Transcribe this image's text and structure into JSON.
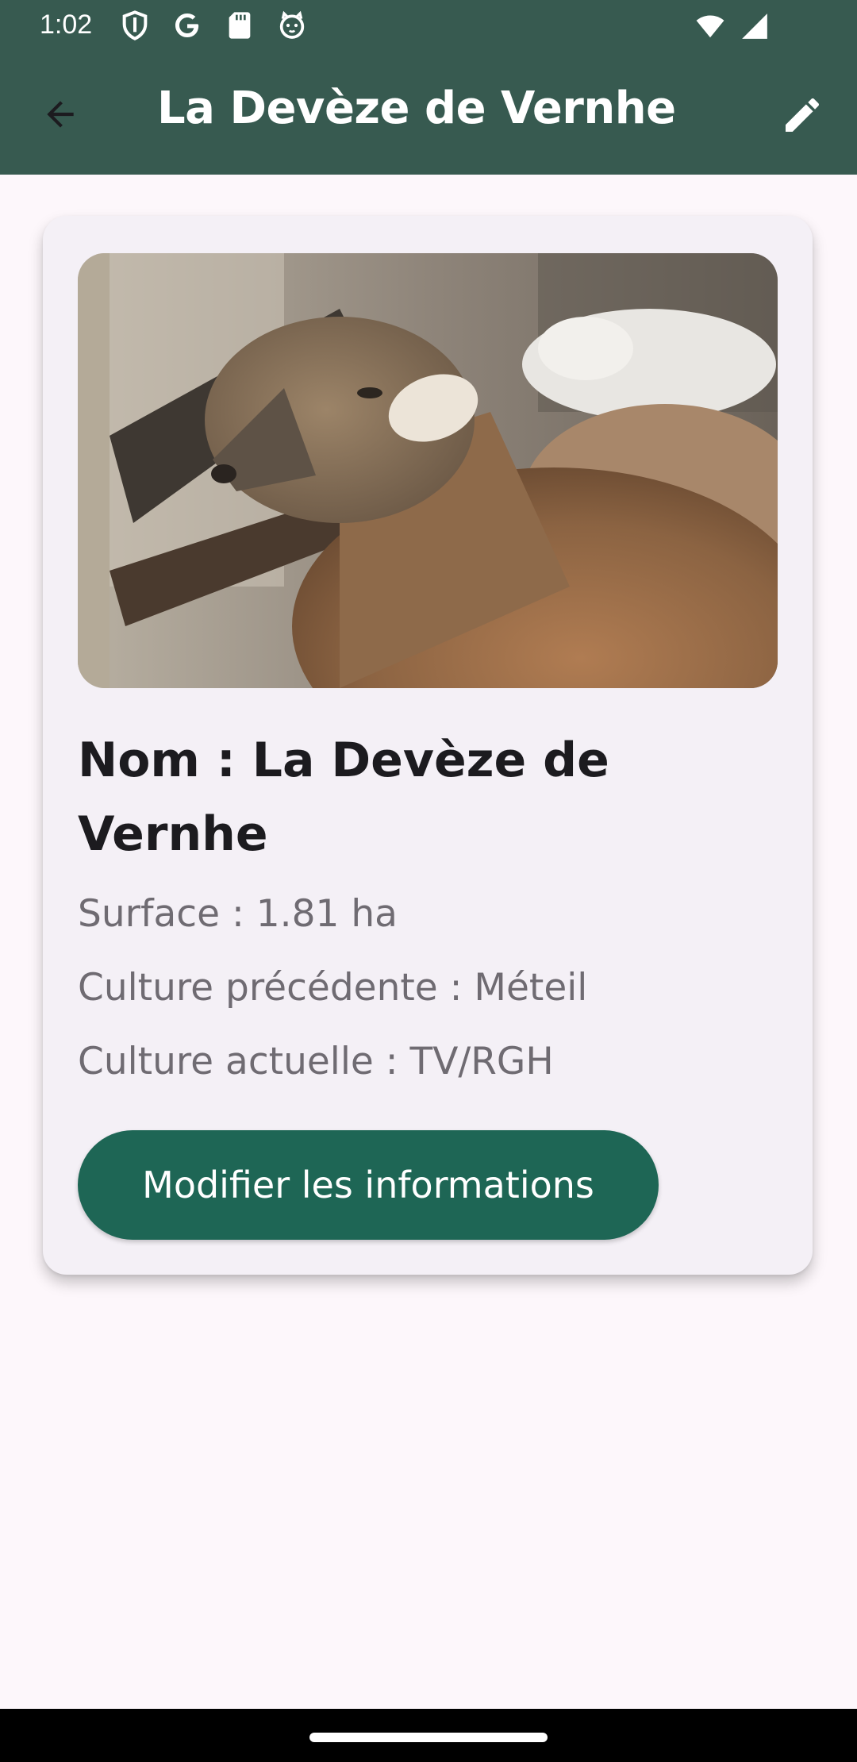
{
  "status_bar": {
    "time": "1:02",
    "left_icons": [
      "shield-icon",
      "google-icon",
      "sd-card-icon",
      "cat-icon"
    ],
    "right_icons": [
      "wifi-icon",
      "cell-signal-icon"
    ]
  },
  "app_bar": {
    "title": "La Devèze de Vernhe",
    "background": "#375a50"
  },
  "card": {
    "image_alt": "sheep-photo",
    "name_heading": "Nom : La Devèze de Vernhe",
    "surface": "Surface : 1.81 ha",
    "previous_crop": "Culture précédente : Méteil",
    "current_crop": "Culture actuelle : TV/RGH",
    "modify_button_label": "Modifier les informations",
    "button_color": "#1e6655"
  }
}
